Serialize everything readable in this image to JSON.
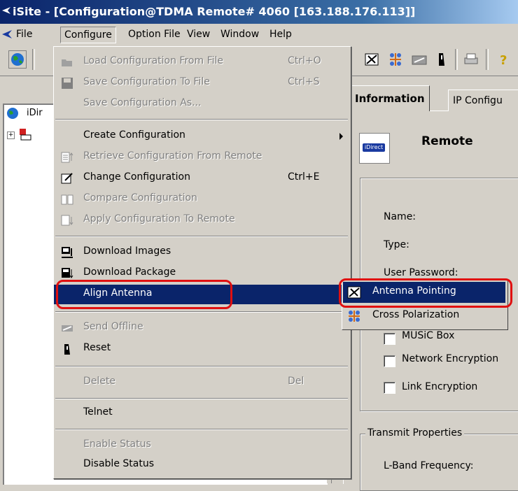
{
  "window": {
    "title": "iSite - [Configuration@TDMA Remote# 4060 [163.188.176.113]]"
  },
  "menubar": {
    "items": [
      "File",
      "Configure",
      "Option File",
      "View",
      "Window",
      "Help"
    ]
  },
  "tree": {
    "root_label": "iDir"
  },
  "configure_menu": {
    "items": [
      {
        "label": "Load Configuration From File",
        "shortcut": "Ctrl+O",
        "enabled": false,
        "icon": "open-folder-icon"
      },
      {
        "label": "Save Configuration To File",
        "shortcut": "Ctrl+S",
        "enabled": false,
        "icon": "floppy-disk-icon"
      },
      {
        "label": "Save Configuration As...",
        "shortcut": "",
        "enabled": false,
        "icon": ""
      },
      {
        "label": "Create Configuration",
        "shortcut": "",
        "enabled": true,
        "icon": "",
        "submenu": true
      },
      {
        "label": "Retrieve Configuration From Remote",
        "shortcut": "",
        "enabled": false,
        "icon": "retrieve-icon"
      },
      {
        "label": "Change Configuration",
        "shortcut": "Ctrl+E",
        "enabled": true,
        "icon": "edit-config-icon"
      },
      {
        "label": "Compare Configuration",
        "shortcut": "",
        "enabled": false,
        "icon": "compare-icon"
      },
      {
        "label": "Apply Configuration To Remote",
        "shortcut": "",
        "enabled": false,
        "icon": "apply-icon"
      },
      {
        "label": "Download Images",
        "shortcut": "",
        "enabled": true,
        "icon": "download-images-icon"
      },
      {
        "label": "Download Package",
        "shortcut": "",
        "enabled": true,
        "icon": "download-package-icon"
      },
      {
        "label": "Align Antenna",
        "shortcut": "",
        "enabled": true,
        "icon": "",
        "submenu": true,
        "selected": true
      },
      {
        "label": "Send Offline",
        "shortcut": "",
        "enabled": false,
        "icon": "send-offline-icon"
      },
      {
        "label": "Reset",
        "shortcut": "",
        "enabled": true,
        "icon": "reset-icon"
      },
      {
        "label": "Delete",
        "shortcut": "Del",
        "enabled": false,
        "icon": ""
      },
      {
        "label": "Telnet",
        "shortcut": "",
        "enabled": true,
        "icon": ""
      },
      {
        "label": "Enable Status",
        "shortcut": "",
        "enabled": false,
        "icon": ""
      },
      {
        "label": "Disable Status",
        "shortcut": "",
        "enabled": true,
        "icon": ""
      }
    ]
  },
  "align_antenna_submenu": {
    "items": [
      {
        "label": "Antenna Pointing",
        "selected": true,
        "icon": "antenna-pointing-icon"
      },
      {
        "label": "Cross Polarization",
        "selected": false,
        "icon": "cross-polarization-icon"
      }
    ]
  },
  "tabs": [
    "Information",
    "IP Configu"
  ],
  "panel": {
    "title": "Remote",
    "remote_icon_text": "iDirect",
    "fields": [
      "Name:",
      "Type:",
      "User Password:"
    ],
    "checkboxes": [
      "MUSiC Box",
      "Network Encryption",
      "Link Encryption"
    ],
    "transmit_group_title": "Transmit Properties",
    "transmit_fields": [
      "L-Band Frequency:"
    ]
  },
  "colors": {
    "highlight": "#0a246a",
    "annotation": "#e01010"
  }
}
